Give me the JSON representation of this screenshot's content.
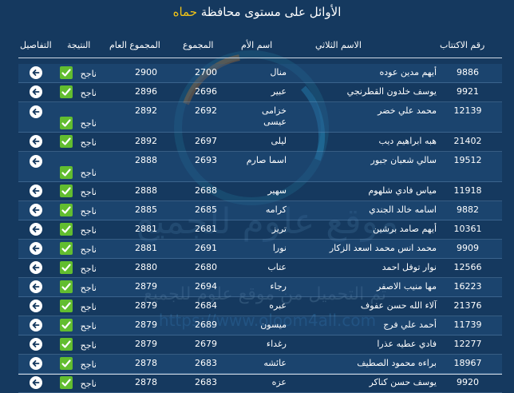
{
  "title": {
    "prefix": "الأوائل على مستوى محافظة",
    "city": "حماه"
  },
  "colors": {
    "background": "#15395f",
    "accent": "#f2c417",
    "success": "#62bd2f"
  },
  "watermark": {
    "site_name": "موقع علوم للجميع",
    "tagline": "تم التحميل من موقع علوم للجميع",
    "url": "https://www.oloom4all.com"
  },
  "columns": {
    "number": "رقم الاكتتاب",
    "name": "الاسم الثلاثي",
    "mother": "اسم الأم",
    "total": "المجموع",
    "grand_total": "المجموع العام",
    "result": "النتيجة",
    "details": "التفاصيل"
  },
  "rows": [
    {
      "number": "9886",
      "name": "أيهم مدين عوده",
      "mother": "منال",
      "total": "2700",
      "grand_total": "2900",
      "result": "ناجح"
    },
    {
      "number": "9921",
      "name": "يوسف خلدون القطرنجي",
      "mother": "عبير",
      "total": "2696",
      "grand_total": "2896",
      "result": "ناجح"
    },
    {
      "number": "12139",
      "name": "محمد علي خضر",
      "mother": "خزامى عيسى",
      "total": "2692",
      "grand_total": "2892",
      "result": "ناجح"
    },
    {
      "number": "21402",
      "name": "هبه ابراهيم ديب",
      "mother": "ليلى",
      "total": "2697",
      "grand_total": "2892",
      "result": "ناجح"
    },
    {
      "number": "19512",
      "name": "سالي شعبان جبور",
      "mother": "اسما صارم",
      "total": "2693",
      "grand_total": "2888",
      "result": "ناجح"
    },
    {
      "number": "11918",
      "name": "مياس فادي شلهوم",
      "mother": "سهير",
      "total": "2688",
      "grand_total": "2888",
      "result": "ناجح"
    },
    {
      "number": "9882",
      "name": "اسامه خالد الجندي",
      "mother": "كرامه",
      "total": "2685",
      "grand_total": "2885",
      "result": "ناجح"
    },
    {
      "number": "10361",
      "name": "أيهم صامد برشين",
      "mother": "تريز",
      "total": "2681",
      "grand_total": "2881",
      "result": "ناجح"
    },
    {
      "number": "9909",
      "name": "محمد انس محمد اسعد الزكار",
      "mother": "نورا",
      "total": "2691",
      "grand_total": "2881",
      "result": "ناجح"
    },
    {
      "number": "12566",
      "name": "نوار توفل احمد",
      "mother": "عتاب",
      "total": "2680",
      "grand_total": "2880",
      "result": "ناجح"
    },
    {
      "number": "16223",
      "name": "مها منيب الاصفر",
      "mother": "رجاء",
      "total": "2694",
      "grand_total": "2879",
      "result": "ناجح"
    },
    {
      "number": "21376",
      "name": "آلاء الله حسن عفوف",
      "mother": "عبره",
      "total": "2684",
      "grand_total": "2879",
      "result": "ناجح"
    },
    {
      "number": "11739",
      "name": "أحمد علي فرج",
      "mother": "ميسون",
      "total": "2689",
      "grand_total": "2879",
      "result": "ناجح"
    },
    {
      "number": "12277",
      "name": "فادي عطيه عذرا",
      "mother": "رغداء",
      "total": "2679",
      "grand_total": "2879",
      "result": "ناجح"
    },
    {
      "number": "18967",
      "name": "براءه محمود الصطيف",
      "mother": "عائشه",
      "total": "2683",
      "grand_total": "2878",
      "result": "ناجح"
    },
    {
      "number": "9920",
      "name": "يوسف حسن كناكر",
      "mother": "عزه",
      "total": "2683",
      "grand_total": "2878",
      "result": "ناجح"
    }
  ]
}
